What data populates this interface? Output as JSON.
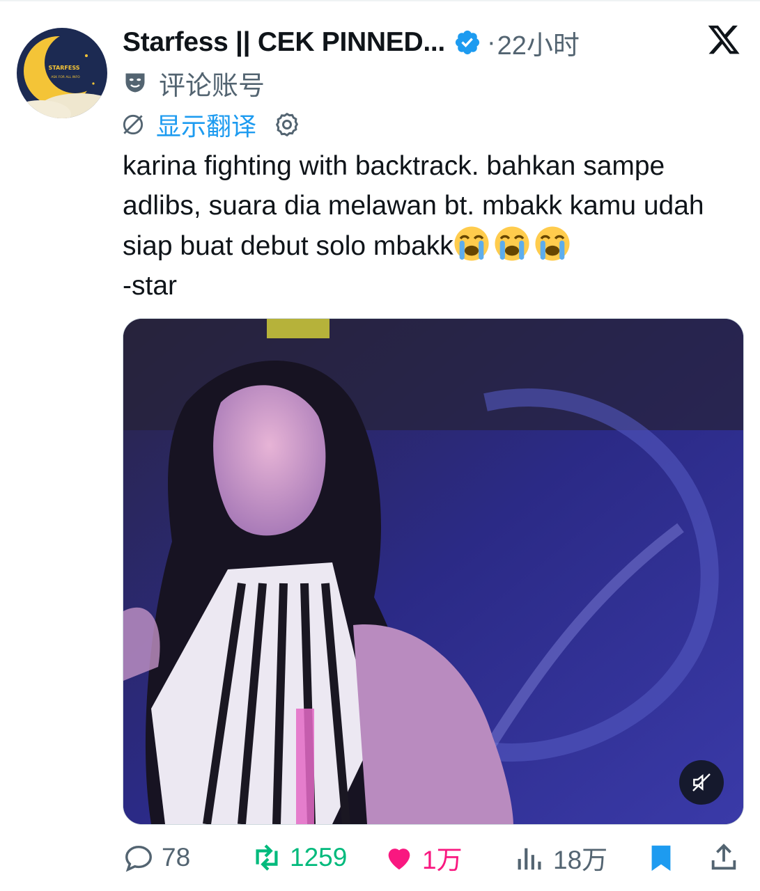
{
  "tweet": {
    "author": {
      "display_name": "Starfess || CEK PINNED...",
      "verified": true,
      "avatar_text": "STARFESS",
      "avatar_subtext": "ASK FOR ALL INFO",
      "handle": "评论账号"
    },
    "time_sep": "·",
    "time": "22小时",
    "translate_label": "显示翻译",
    "text": "karina fighting with backtrack. bahkan sampe adlibs, suara dia melawan bt. mbakk kamu udah siap buat debut solo mbakk",
    "signature": "-star",
    "emoji": [
      "loudly-crying-face",
      "loudly-crying-face",
      "loudly-crying-face"
    ],
    "media": {
      "type": "video",
      "muted": true,
      "alt": "performer with long dark hair in black-and-white fringed top on purple-lit stage"
    },
    "actions": {
      "replies": "78",
      "retweets": "1259",
      "likes": "1万",
      "views": "18万"
    }
  },
  "colors": {
    "accent": "#1d9bf0",
    "retweet": "#00ba7c",
    "like": "#f91880",
    "secondary_text": "#536471"
  }
}
